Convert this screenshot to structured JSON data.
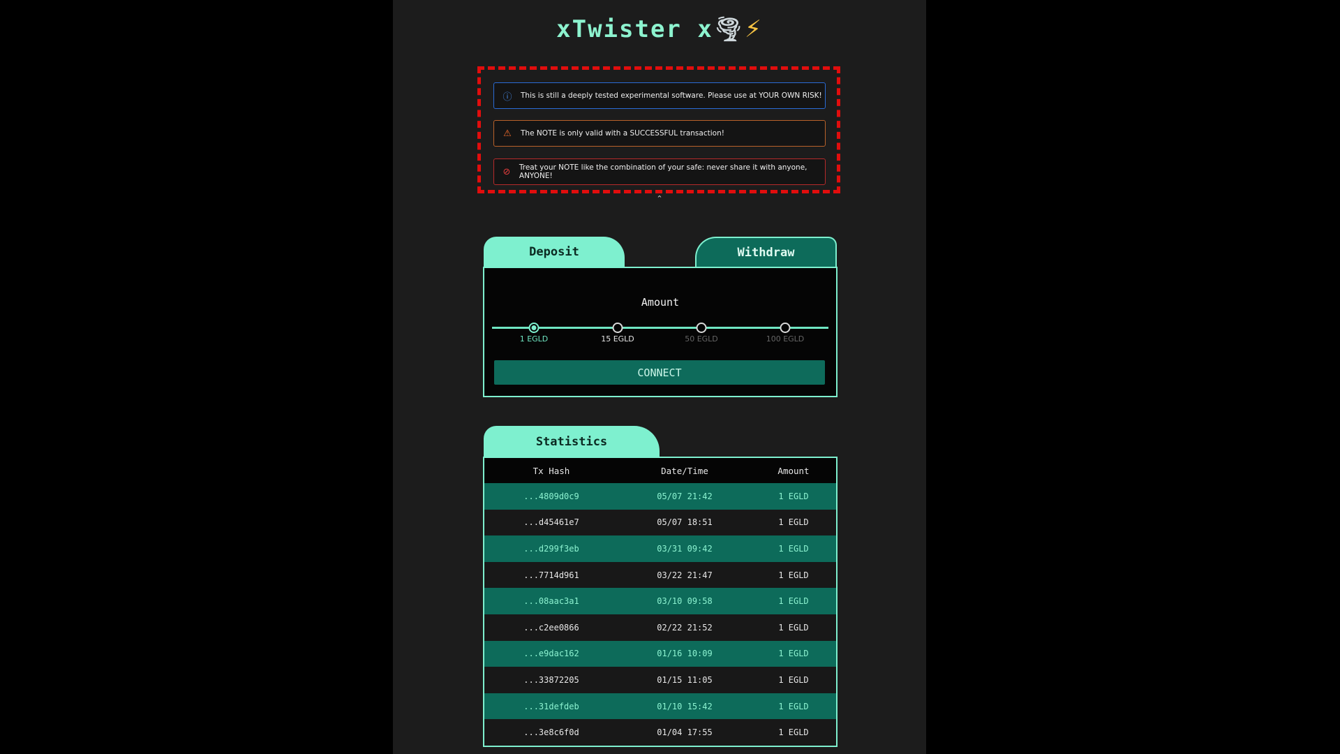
{
  "app": {
    "title": "xTwister x",
    "title_icons": [
      "tornado-icon",
      "lightning-icon"
    ]
  },
  "notices": [
    {
      "type": "info",
      "icon": "info-icon",
      "text": "This is still a deeply tested experimental software. Please use at YOUR OWN RISK!",
      "color": "#2a6bd6"
    },
    {
      "type": "warning",
      "icon": "warning-icon",
      "text": "The NOTE is only valid with a SUCCESSFUL transaction!",
      "color": "#ef6b2c"
    },
    {
      "type": "error",
      "icon": "alert-icon",
      "text": "Treat your NOTE like the combination of your safe: never share it with anyone, ANYONE!",
      "color": "#e53d3d"
    }
  ],
  "tabs": {
    "deposit": "Deposit",
    "withdraw": "Withdraw",
    "active": "deposit"
  },
  "deposit": {
    "amount_label": "Amount",
    "options": [
      "1 EGLD",
      "15 EGLD",
      "50 EGLD",
      "100 EGLD"
    ],
    "selected": "1 EGLD",
    "connect_label": "CONNECT"
  },
  "statistics": {
    "tab_label": "Statistics",
    "columns": [
      "Tx Hash",
      "Date/Time",
      "Amount"
    ],
    "rows": [
      [
        "...4809d0c9",
        "05/07 21:42",
        "1 EGLD"
      ],
      [
        "...d45461e7",
        "05/07 18:51",
        "1 EGLD"
      ],
      [
        "...d299f3eb",
        "03/31 09:42",
        "1 EGLD"
      ],
      [
        "...7714d961",
        "03/22 21:47",
        "1 EGLD"
      ],
      [
        "...08aac3a1",
        "03/10 09:58",
        "1 EGLD"
      ],
      [
        "...c2ee0866",
        "02/22 21:52",
        "1 EGLD"
      ],
      [
        "...e9dac162",
        "01/16 10:09",
        "1 EGLD"
      ],
      [
        "...33872205",
        "01/15 11:05",
        "1 EGLD"
      ],
      [
        "...31defdeb",
        "01/10 15:42",
        "1 EGLD"
      ],
      [
        "...3e8c6f0d",
        "01/04 17:55",
        "1 EGLD"
      ]
    ]
  },
  "colors": {
    "accent": "#7ef0cf",
    "accent_dark": "#0d6b5a",
    "highlight_frame": "#e10d0d"
  }
}
